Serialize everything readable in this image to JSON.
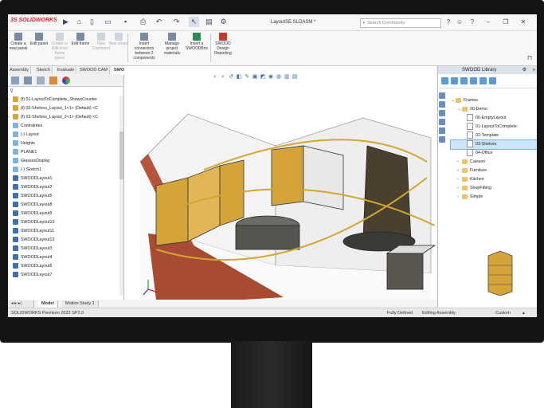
{
  "app": {
    "logo_text": "3S SOLIDWORKS",
    "document_title": "LayoutSE.SLDASM *",
    "search_placeholder": "Search Commands"
  },
  "command_manager": {
    "buttons": [
      {
        "label": "Create a new panel",
        "disabled": false
      },
      {
        "label": "Edit panel",
        "disabled": false
      },
      {
        "label": "Create or Edit from frame panel",
        "disabled": true
      },
      {
        "label": "Edit frame",
        "disabled": false
      },
      {
        "label": "New Cupboard",
        "disabled": true
      },
      {
        "label": "New shape",
        "disabled": true
      },
      {
        "label": "Insert connectors between 2 components",
        "disabled": false
      },
      {
        "label": "Manage project materials",
        "disabled": false
      },
      {
        "label": "Insert a SWOODBox",
        "disabled": false
      },
      {
        "label": "SWOOD Design Reporting",
        "disabled": false
      }
    ]
  },
  "tabs": [
    "Assembly",
    "Sketch",
    "Evaluate",
    "SWOOD CAM",
    "SWOOD Design"
  ],
  "active_tab": "SWOOD Design",
  "feature_tree": [
    {
      "label": "(f) 01-LayoutToComplete_ShowsCounter",
      "type": "asm"
    },
    {
      "label": "(f) 03-Shelves_Layout_1<1> (Default) <C",
      "type": "asm"
    },
    {
      "label": "(f) 03-Shelves_Layout_2<1> (Default) <C",
      "type": "asm"
    },
    {
      "label": "Contraintes",
      "type": "ref"
    },
    {
      "label": "(-) Layout",
      "type": "ref"
    },
    {
      "label": "Heights",
      "type": "ref"
    },
    {
      "label": "PLANE1",
      "type": "ref"
    },
    {
      "label": "GlassesDisplay",
      "type": "ref"
    },
    {
      "label": "(-) Sketch1",
      "type": "ref"
    },
    {
      "label": "SWOODLayout1",
      "type": "part"
    },
    {
      "label": "SWOODLayout2",
      "type": "part"
    },
    {
      "label": "SWOODLayout5",
      "type": "part"
    },
    {
      "label": "SWOODLayout8",
      "type": "part"
    },
    {
      "label": "SWOODLayout9",
      "type": "part"
    },
    {
      "label": "SWOODLayout10",
      "type": "part"
    },
    {
      "label": "SWOODLayout11",
      "type": "part"
    },
    {
      "label": "SWOODLayout13",
      "type": "part"
    },
    {
      "label": "SWOODLayout3",
      "type": "part"
    },
    {
      "label": "SWOODLayout4",
      "type": "part"
    },
    {
      "label": "SWOODLayout6",
      "type": "part"
    },
    {
      "label": "SWOODLayout7",
      "type": "part"
    }
  ],
  "bottom_tabs": [
    "Model",
    "Motion Study 1"
  ],
  "status_bar": {
    "left": "SOLIDWORKS Premium 2022 SP2.0",
    "state": "Fully Defined",
    "mode": "Editing Assembly",
    "units": "Custom"
  },
  "library": {
    "title": "SWOOD Library",
    "root": "Frames",
    "items": [
      {
        "label": "00-Demo",
        "kind": "folder",
        "level": 1
      },
      {
        "label": "00-EmptyLayout",
        "kind": "doc",
        "level": 2
      },
      {
        "label": "01-LayoutToComplete",
        "kind": "doc",
        "level": 2
      },
      {
        "label": "02-Template",
        "kind": "doc",
        "level": 2
      },
      {
        "label": "03-Shelves",
        "kind": "doc",
        "level": 2,
        "selected": true
      },
      {
        "label": "04-Office",
        "kind": "doc",
        "level": 2
      },
      {
        "label": "Caisson",
        "kind": "folder",
        "level": 1
      },
      {
        "label": "Furniture",
        "kind": "folder",
        "level": 1
      },
      {
        "label": "Kitchen",
        "kind": "folder",
        "level": 1
      },
      {
        "label": "ShopFitting",
        "kind": "folder",
        "level": 1
      },
      {
        "label": "Simple",
        "kind": "folder",
        "level": 1
      }
    ]
  },
  "colors": {
    "accent": "#2f6db5",
    "brand": "#d2232a",
    "brick": "#b5553c",
    "shelf": "#d4a43a",
    "selection": "#cce4f7"
  }
}
